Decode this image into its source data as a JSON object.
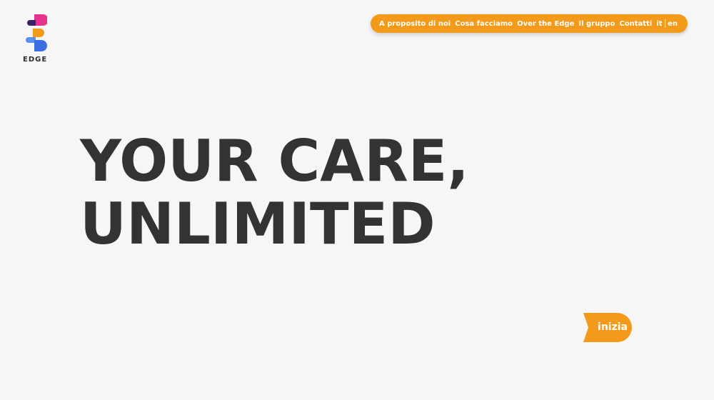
{
  "brand": {
    "name": "EDGE",
    "logo_colors": [
      "#e6328c",
      "#3a1f6b",
      "#f39a1a",
      "#3b6fe0"
    ]
  },
  "nav": {
    "items": [
      {
        "label": "A proposito di noi"
      },
      {
        "label": "Cosa facciamo"
      },
      {
        "label": "Over the Edge"
      },
      {
        "label": "Il gruppo"
      },
      {
        "label": "Contatti"
      }
    ],
    "languages": {
      "current": "it",
      "other": "en"
    },
    "background_color": "#f39a1a"
  },
  "hero": {
    "line1": "YOUR CARE,",
    "line2": "UNLIMITED",
    "color": "#333333"
  },
  "cta": {
    "label": "inizia",
    "color": "#f39a1a"
  }
}
